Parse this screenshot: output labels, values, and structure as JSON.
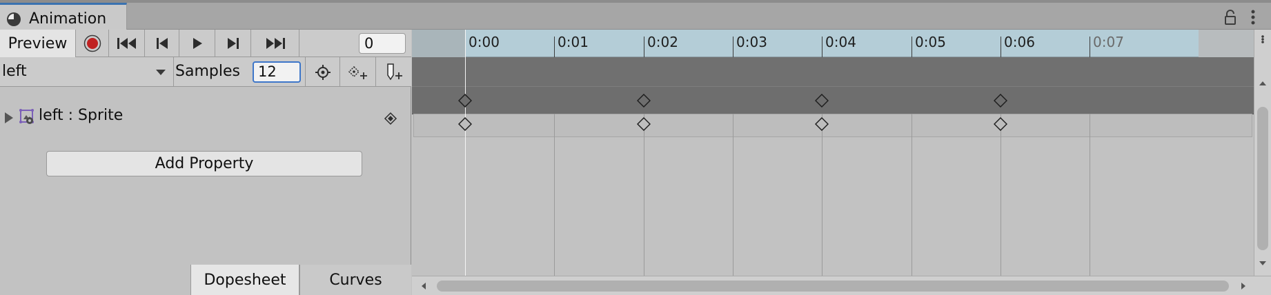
{
  "window": {
    "tab_title": "Animation"
  },
  "toolbar": {
    "preview_label": "Preview",
    "current_frame": "0"
  },
  "clip": {
    "selected_clip": "left",
    "samples_label": "Samples",
    "samples_value": "12"
  },
  "properties": [
    {
      "label": "left : Sprite"
    }
  ],
  "add_property_label": "Add Property",
  "bottom_tabs": {
    "dopesheet": "Dopesheet",
    "curves": "Curves"
  },
  "timeline": {
    "ticks": [
      "0:00",
      "0:01",
      "0:02",
      "0:03",
      "0:04",
      "0:05",
      "0:06",
      "0:07"
    ],
    "keyframe_times": [
      "0:00",
      "0:02",
      "0:04",
      "0:06"
    ]
  },
  "colors": {
    "record": "#c02222",
    "selection": "#3d76c9",
    "tab_accent": "#3a72b0"
  }
}
